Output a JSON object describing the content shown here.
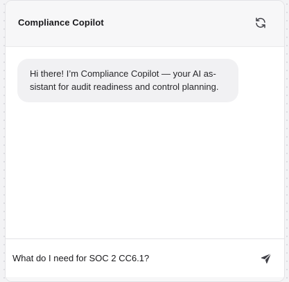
{
  "header": {
    "title": "Compliance Copilot",
    "refresh_icon": "refresh-icon"
  },
  "messages": [
    {
      "role": "assistant",
      "text": "Hi there! I’m Compliance Copilot — your AI as­sistant for audit readiness and control planning."
    }
  ],
  "composer": {
    "value": "What do I need for SOC 2 CC6.1?",
    "placeholder": "",
    "send_icon": "send-icon"
  },
  "colors": {
    "panel_bg": "#ffffff",
    "header_bg": "#f7f7f8",
    "bubble_bg": "#f1f1f3",
    "text": "#18181b",
    "icon": "#3f3f46"
  }
}
